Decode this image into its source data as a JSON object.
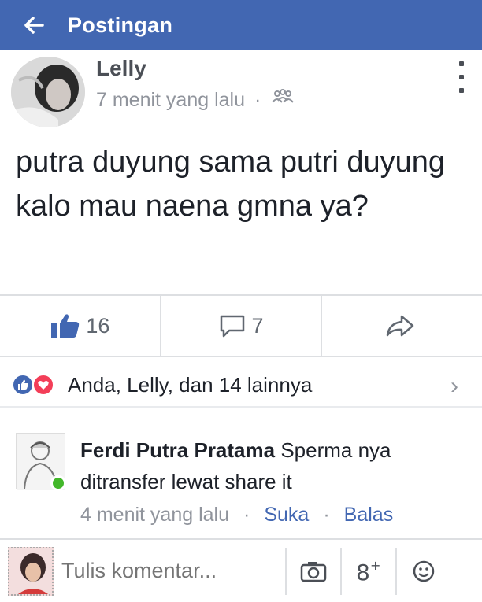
{
  "header": {
    "back_icon": "arrow-left-icon",
    "title": "Postingan"
  },
  "post": {
    "author": "Lelly",
    "time": "7 menit yang lalu",
    "meta_separator": "·",
    "audience_icon": "friends-icon",
    "menu_icon": "kebab-menu-icon",
    "text": "putra duyung sama putri duyung kalo mau naena gmna ya?"
  },
  "actions": {
    "like_count": "16",
    "comment_count": "7",
    "share_icon": "share-icon"
  },
  "reactions": {
    "text": "Anda, Lelly, dan 14 lainnya",
    "icons": [
      "like-icon",
      "love-icon"
    ],
    "chevron": "›"
  },
  "comment": {
    "author": "Ferdi Putra Pratama",
    "text": " Sperma nya ditransfer lewat share it",
    "time": "4 menit yang lalu",
    "separator": "·",
    "like_label": "Suka",
    "reply_label": "Balas"
  },
  "composer": {
    "placeholder": "Tulis komentar...",
    "tools": [
      "camera-icon",
      "gplus-icon",
      "emoji-icon"
    ]
  },
  "colors": {
    "brand": "#4267b2",
    "online": "#42b72a",
    "love": "#f33e58"
  }
}
